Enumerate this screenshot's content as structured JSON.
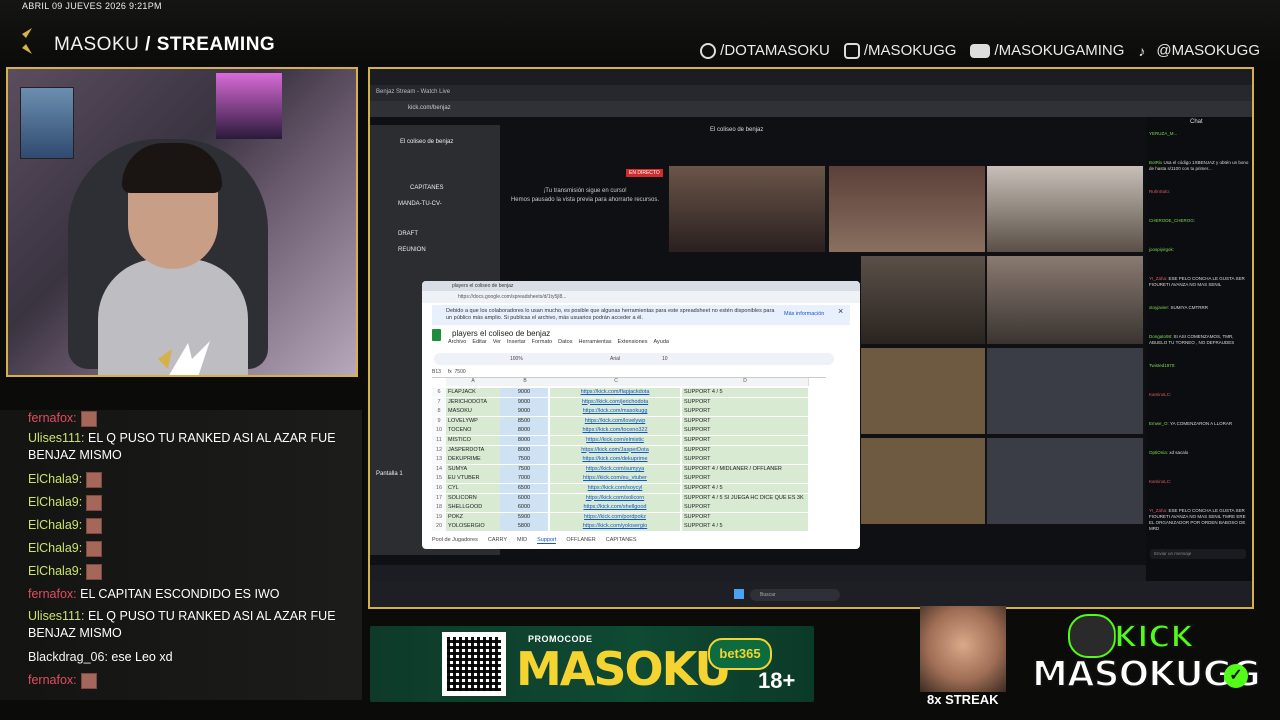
{
  "overlay": {
    "datetime": "ABRIL 09 JUEVES 2026 9:21PM",
    "brand_name": "MASOKU",
    "brand_suffix": "/ STREAMING",
    "socials": [
      {
        "icon": "facebook-icon",
        "label": "/DOTAMASOKU"
      },
      {
        "icon": "instagram-icon",
        "label": "/MASOKUGG"
      },
      {
        "icon": "youtube-icon",
        "label": "/MASOKUGAMING"
      },
      {
        "icon": "tiktok-icon",
        "label": "@MASOKUGG"
      }
    ],
    "accent_color": "#d6b04a"
  },
  "stream_chat": [
    {
      "user": "ElChala9:",
      "text": "",
      "color": "green"
    },
    {
      "user": "Ulises111:",
      "text": "EL Q PUSO TU RANKED ASI AL AZAR FUE BENJAZ MISMO",
      "color": "green"
    },
    {
      "user": "ElChala9:",
      "text": "",
      "color": "green"
    },
    {
      "user": "ElChala9:",
      "text": "",
      "color": "green"
    },
    {
      "user": "ElChala9:",
      "text": "",
      "color": "green"
    },
    {
      "user": "ElChala9:",
      "text": "",
      "color": "green"
    },
    {
      "user": "ElChala9:",
      "text": "",
      "color": "green"
    },
    {
      "user": "fernafox:",
      "text": "EL CAPITAN ESCONDIDO ES IWO",
      "color": "pink"
    },
    {
      "user": "Ulises111:",
      "text": "EL Q PUSO TU RANKED ASI AL AZAR FUE BENJAZ MISMO",
      "color": "green"
    },
    {
      "user": "Blackdrag_06:",
      "text": "ese Leo xd",
      "color": "white"
    },
    {
      "user": "fernafox:",
      "text": "",
      "color": "pink"
    }
  ],
  "screen": {
    "browser_tab": "Benjaz Stream - Watch Live",
    "browser_url": "kick.com/benjaz",
    "kick_title": "El coliseo de benjaz",
    "live_badge": "EN DIRECTO",
    "notice_title": "¡Tu transmisión sigue en curso!",
    "notice_body": "Hemos pausado la vista previa para ahorrarte recursos.",
    "discord_server": "El coliseo de benjaz",
    "discord_channels": [
      "CAPITANES",
      "MANDA-TU-CV-",
      "DRAFT",
      "REUNION",
      "Pantalla 1"
    ],
    "sheets": {
      "tab": "players el coliseo de benjaz",
      "url": "https://docs.google.com/spreadsheets/d/1ty5jl8...",
      "warning": "Debido a que los colaboradores lo usan mucho, es posible que algunas herramientas para este spreadsheet no estén disponibles para un público más amplio. Si publicas el archivo, más usuarios podrán acceder a él.",
      "more_info": "Más información",
      "title": "players el coliseo de benjaz",
      "menu": [
        "Archivo",
        "Editar",
        "Ver",
        "Insertar",
        "Formato",
        "Datos",
        "Herramientas",
        "Extensiones",
        "Ayuda"
      ],
      "zoom": "100%",
      "font": "Arial",
      "font_size": "10",
      "cell_ref": "B13",
      "formula": "7500",
      "columns": [
        "A",
        "B",
        "C",
        "D"
      ],
      "rows": [
        {
          "n": "6",
          "name": "FLAPJACK",
          "mmr": "9000",
          "link": "https://kick.com/flapjackdota",
          "role": "SUPPORT 4 / 5"
        },
        {
          "n": "7",
          "name": "JERICHODOTA",
          "mmr": "9000",
          "link": "https://kick.com/jerichodota",
          "role": "SUPPORT"
        },
        {
          "n": "8",
          "name": "MASOKU",
          "mmr": "9000",
          "link": "https://kick.com/masokugg",
          "role": "SUPPORT"
        },
        {
          "n": "9",
          "name": "LOVELYWP",
          "mmr": "8500",
          "link": "https://kick.com/lovelywp",
          "role": "SUPPORT"
        },
        {
          "n": "10",
          "name": "TOCENO",
          "mmr": "8000",
          "link": "https://kick.com/toceno322",
          "role": "SUPPORT"
        },
        {
          "n": "11",
          "name": "MISTICO",
          "mmr": "8000",
          "link": "https://kick.com/elmistic",
          "role": "SUPPORT"
        },
        {
          "n": "12",
          "name": "JASPERDOTA",
          "mmr": "8000",
          "link": "https://kick.com/JasperDota",
          "role": "SUPPORT"
        },
        {
          "n": "13",
          "name": "DEKUPRIME",
          "mmr": "7500",
          "link": "https://kick.com/dekuprime",
          "role": "SUPPORT"
        },
        {
          "n": "14",
          "name": "SUMYA",
          "mmr": "7500",
          "link": "https://kick.com/sumyya",
          "role": "SUPPORT 4 / MIDLANER / OFFLANER"
        },
        {
          "n": "15",
          "name": "EU VTUBER",
          "mmr": "7000",
          "link": "https://kick.com/eu_vtuber",
          "role": "SUPPORT"
        },
        {
          "n": "16",
          "name": "CYL",
          "mmr": "6500",
          "link": "https://kick.com/soycyl",
          "role": "SUPPORT 4 / 5"
        },
        {
          "n": "17",
          "name": "SOLICORN",
          "mmr": "6000",
          "link": "https://kick.com/solicorn",
          "role": "SUPPORT 4 / 5 SI JUEGA HC DICE QUE ES 3K"
        },
        {
          "n": "18",
          "name": "SHELLGOOD",
          "mmr": "6000",
          "link": "https://kick.com/shellgood",
          "role": "SUPPORT"
        },
        {
          "n": "19",
          "name": "POKZ",
          "mmr": "5900",
          "link": "https://kick.com/pordpokz",
          "role": "SUPPORT"
        },
        {
          "n": "20",
          "name": "YOLOSERGIO",
          "mmr": "5800",
          "link": "https://kick.com/yolosergio",
          "role": "SUPPORT 4 / 5"
        }
      ],
      "sheet_tabs": [
        "Pool de Jugadores",
        "CARRY",
        "MID",
        "Support",
        "OFFLANER",
        "CAPITANES"
      ],
      "active_sheet_tab": "Support"
    },
    "taskbar_search": "Buscar",
    "voice_tiles": [
      "",
      "",
      "",
      "",
      "",
      "",
      "",
      "",
      ""
    ],
    "kick_chat": {
      "title": "Chat",
      "lines": [
        {
          "user": "YERUZA_M...",
          "text": "",
          "red": false
        },
        {
          "user": "BotRix",
          "text": "Usa el código 1XBENJAZ y obtén un bono de hasta s/1100 con tu primer...",
          "red": false
        },
        {
          "user": "RuhnSolo:",
          "text": "",
          "red": true
        },
        {
          "user": "CHERODE_CHEROG:",
          "text": "",
          "red": false
        },
        {
          "user": "joospiyirgok:",
          "text": "",
          "red": false
        },
        {
          "user": "YI_Zaha:",
          "text": "ESE PELO CONCHA LE GUSTA SER FIOURETI AVANZA NO MAS SENIL",
          "red": true
        },
        {
          "user": "xtoyjavier:",
          "text": "SUMIYA CMTRRR",
          "red": false
        },
        {
          "user": "Dongato98:",
          "text": "SI ASI COMENZAMOS, TMR, ABUELO TU TORNEO , NO DEFRAUDES",
          "red": false
        },
        {
          "user": "Twisted1970:",
          "text": "",
          "red": false
        },
        {
          "user": "KaminoLC:",
          "text": "",
          "red": true
        },
        {
          "user": "Emwe_O:",
          "text": "YA COMENZARON A LLORAR",
          "red": false
        },
        {
          "user": "OptiOnia:",
          "text": "xd sacalo",
          "red": false
        },
        {
          "user": "KaminoLC:",
          "text": "",
          "red": true
        },
        {
          "user": "YI_Zaha:",
          "text": "ESE PELO CONCHA LE GUSTA SER FIOURETI AVANZA NO MAS SENIL TMRE ERE EL ORGANIZADOR POR ORDEN BABOSO DE MRD",
          "red": true
        }
      ],
      "input_placeholder": "Enviar un mensaje"
    }
  },
  "promo": {
    "label": "PROMOCODE",
    "code": "MASOKU",
    "sponsor": "bet365",
    "age": "18+"
  },
  "streak": {
    "label": "8x STREAK"
  },
  "kick_brand": {
    "word": "KICK",
    "name": "MASOKUGG",
    "check": "✓",
    "color": "#53fc18"
  }
}
